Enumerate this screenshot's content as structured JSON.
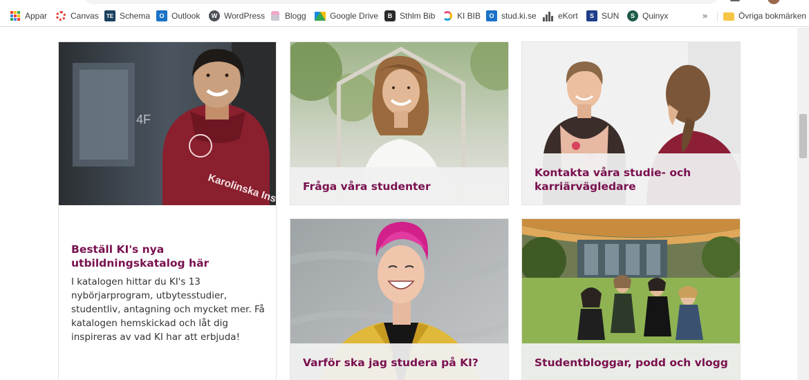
{
  "bookmarks": [
    {
      "label": "Appar",
      "icon": "apps-grid-icon"
    },
    {
      "label": "Canvas",
      "icon": "canvas-icon"
    },
    {
      "label": "Schema",
      "icon": "timeedit-icon",
      "badge": "TE"
    },
    {
      "label": "Outlook",
      "icon": "outlook-icon",
      "badge": "O"
    },
    {
      "label": "WordPress",
      "icon": "wordpress-icon",
      "badge": "W"
    },
    {
      "label": "Blogg",
      "icon": "blog-icon"
    },
    {
      "label": "Google Drive",
      "icon": "google-drive-icon"
    },
    {
      "label": "Sthlm Bib",
      "icon": "library-icon",
      "badge": "B"
    },
    {
      "label": "KI BIB",
      "icon": "ki-bib-icon"
    },
    {
      "label": "stud.ki.se",
      "icon": "outlook-icon",
      "badge": "O"
    },
    {
      "label": "eKort",
      "icon": "ekort-icon"
    },
    {
      "label": "SUN",
      "icon": "sun-icon",
      "badge": "S"
    },
    {
      "label": "Quinyx",
      "icon": "quinyx-icon",
      "badge": "S"
    }
  ],
  "bookmarks_overflow": "»",
  "other_bookmarks": {
    "label": "Övriga bokmärken",
    "icon": "folder-icon"
  },
  "cards": {
    "catalog": {
      "title": "Beställ KI's nya utbildningskatalog här",
      "text": "I katalogen hittar du KI's 13 nybörjarprogram, utbytesstudier, studentliv, antagning och mycket mer.  Få katalogen hemskickad och låt dig inspireras av vad KI har att erbjuda!",
      "hoodie_print": "Karolinska Institutet"
    },
    "ask_students": {
      "title": "Fråga våra studenter"
    },
    "contact_advisors": {
      "title": "Kontakta våra studie- och karriärvägledare"
    },
    "why_study": {
      "title": "Varför ska jag studera på KI?"
    },
    "student_blogs": {
      "title": "Studentbloggar, podd och vlogg"
    }
  },
  "colors": {
    "accent": "#79104f",
    "caption_bg": "#f0f0f0",
    "card_border": "#e4e4e4"
  }
}
